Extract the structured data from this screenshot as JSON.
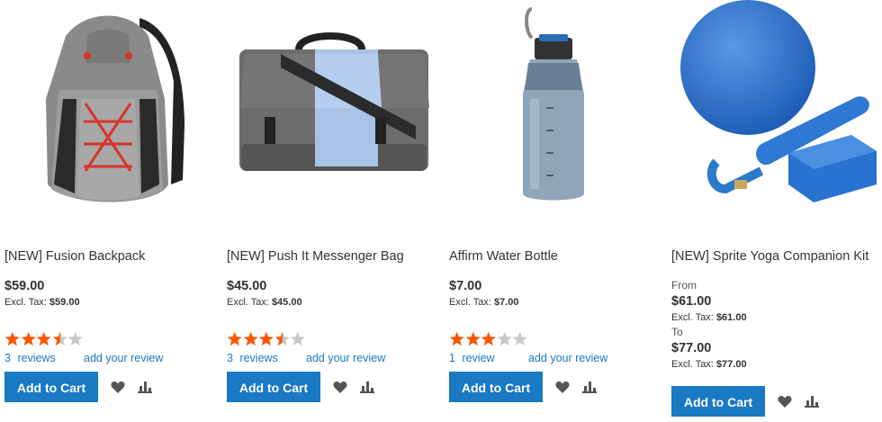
{
  "products": [
    {
      "name": "[NEW] Fusion Backpack",
      "price": "$59.00",
      "excl_label": "Excl. Tax:",
      "excl_value": "$59.00",
      "rating": 3.5,
      "review_count": "3",
      "review_word": "reviews",
      "add_review": "add your review",
      "add_to_cart": "Add to Cart"
    },
    {
      "name": "[NEW] Push It Messenger Bag",
      "price": "$45.00",
      "excl_label": "Excl. Tax:",
      "excl_value": "$45.00",
      "rating": 3.5,
      "review_count": "3",
      "review_word": "reviews",
      "add_review": "add your review",
      "add_to_cart": "Add to Cart"
    },
    {
      "name": "Affirm Water Bottle",
      "price": "$7.00",
      "excl_label": "Excl. Tax:",
      "excl_value": "$7.00",
      "rating": 3,
      "review_count": "1",
      "review_word": "review",
      "add_review": "add your review",
      "add_to_cart": "Add to Cart"
    },
    {
      "name": "[NEW] Sprite Yoga Companion Kit",
      "from_label": "From",
      "price_from": "$61.00",
      "excl_label": "Excl. Tax:",
      "excl_from": "$61.00",
      "to_label": "To",
      "price_to": "$77.00",
      "excl_to": "$77.00",
      "add_to_cart": "Add to Cart"
    }
  ],
  "icons": {
    "wishlist": "heart-icon",
    "compare": "compare-bars-icon",
    "star": "star-icon"
  },
  "colors": {
    "primary": "#1979c3",
    "star_filled": "#ff5501",
    "star_empty": "#c7c7c7",
    "text": "#333333"
  }
}
